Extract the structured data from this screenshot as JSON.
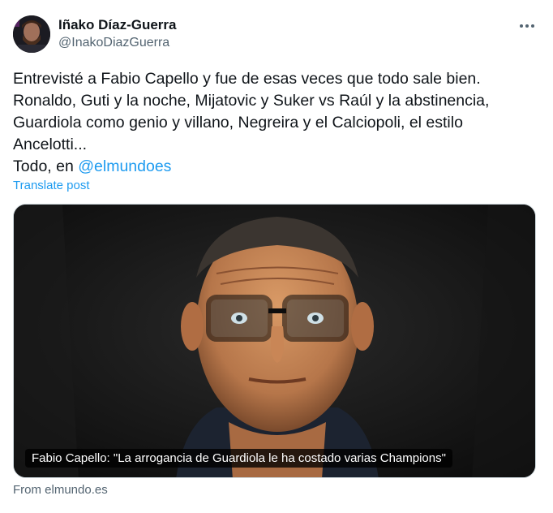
{
  "author": {
    "name": "Iñako Díaz-Guerra",
    "handle": "@InakoDiazGuerra",
    "avatar_icon": "user-avatar"
  },
  "more_icon": "more-horizontal-icon",
  "tweet": {
    "lines": [
      "Entrevisté a Fabio Capello y fue de esas veces que todo sale bien.",
      "Ronaldo, Guti y la noche, Mijatovic y Suker vs Raúl y la abstinencia,",
      "Guardiola como genio y villano, Negreira y el Calciopoli, el estilo",
      "Ancelotti..."
    ],
    "last_line_prefix": "Todo, en ",
    "mention": "@elmundoes"
  },
  "translate_label": "Translate post",
  "card": {
    "caption": "Fabio Capello: \"La arrogancia de Guardiola le ha costado varias Champions\"",
    "image_alt": "portrait-photo"
  },
  "source_label": "From elmundo.es",
  "colors": {
    "text": "#0f1419",
    "secondary": "#536471",
    "link": "#1d9bf0",
    "border": "#cfd9de"
  }
}
